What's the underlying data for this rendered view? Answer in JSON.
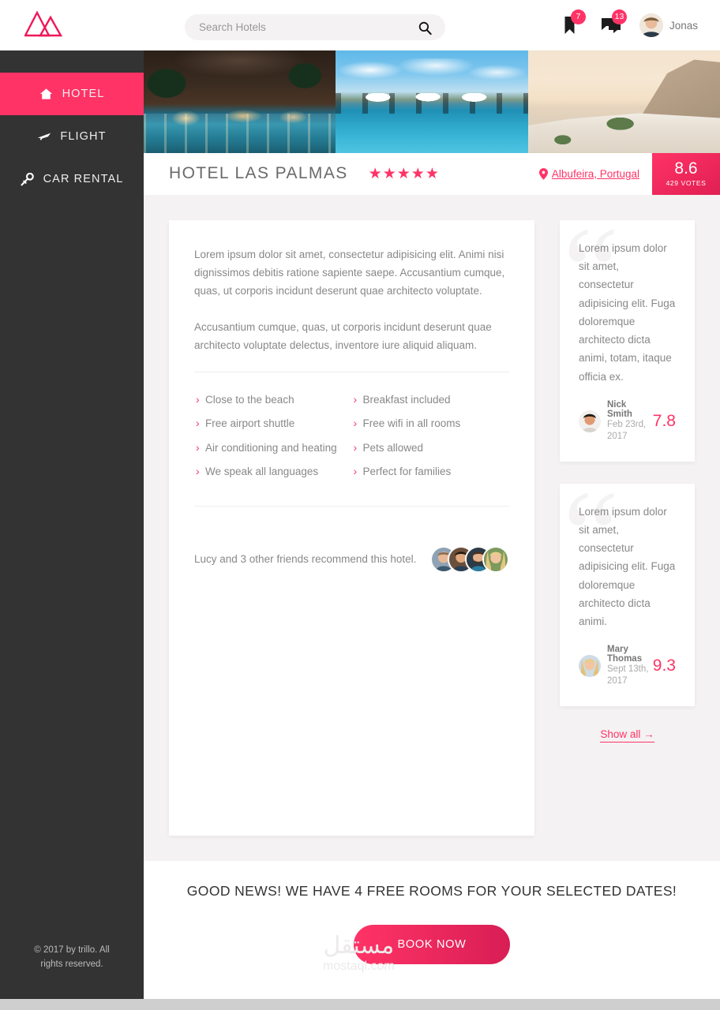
{
  "brand": {
    "logo_icon": "trillo-triangles-logo"
  },
  "search": {
    "placeholder": "Search Hotels",
    "value": "",
    "icon": "search-icon"
  },
  "user_nav": {
    "bookmark": {
      "icon": "bookmark-icon",
      "count": "7"
    },
    "messages": {
      "icon": "chat-bubbles-icon",
      "count": "13"
    },
    "user": {
      "name": "Jonas",
      "avatar": "user-avatar"
    }
  },
  "sidebar": {
    "items": [
      {
        "label": "HOTEL",
        "icon": "home-icon",
        "active": true
      },
      {
        "label": "FLIGHT",
        "icon": "airplane-icon",
        "active": false
      },
      {
        "label": "CAR RENTAL",
        "icon": "key-icon",
        "active": false
      }
    ],
    "legal": "© 2017 by trillo. All rights reserved."
  },
  "gallery": [
    {
      "alt": "Hotel pool at night with palm trees"
    },
    {
      "alt": "Poolside sun loungers and white umbrellas by day"
    },
    {
      "alt": "Clifftop terrace overlooking the sea at sunset"
    }
  ],
  "overview": {
    "name": "HOTEL LAS PALMAS",
    "stars": 5,
    "location": {
      "icon": "location-pin-icon",
      "label": "Albufeira, Portugal"
    },
    "rating": {
      "value": "8.6",
      "count": "429 VOTES"
    }
  },
  "description": {
    "paragraphs": [
      "Lorem ipsum dolor sit amet, consectetur adipisicing elit. Animi nisi dignissimos debitis ratione sapiente saepe. Accusantium cumque, quas, ut corporis incidunt deserunt quae architecto voluptate.",
      "Accusantium cumque, quas, ut corporis incidunt deserunt quae architecto voluptate delectus, inventore iure aliquid aliquam."
    ],
    "features": [
      "Close to the beach",
      "Breakfast included",
      "Free airport shuttle",
      "Free wifi in all rooms",
      "Air conditioning and heating",
      "Pets allowed",
      "We speak all languages",
      "Perfect for families"
    ],
    "recommend": {
      "text": "Lucy and 3 other friends recommend this hotel.",
      "friend_count": 4
    }
  },
  "reviews": [
    {
      "text": "Lorem ipsum dolor sit amet, consectetur adipisicing elit. Fuga doloremque architecto dicta animi, totam, itaque officia ex.",
      "name": "Nick Smith",
      "date": "Feb 23rd, 2017",
      "score": "7.8",
      "photo": "reviewer-avatar-nick"
    },
    {
      "text": "Lorem ipsum dolor sit amet, consectetur adipisicing elit. Fuga doloremque architecto dicta animi.",
      "name": "Mary Thomas",
      "date": "Sept 13th, 2017",
      "score": "9.3",
      "photo": "reviewer-avatar-mary"
    }
  ],
  "reviews_show_all": "Show all →",
  "cta": {
    "title": "GOOD NEWS! WE HAVE 4 FREE ROOMS FOR YOUR SELECTED DATES!",
    "button": "BOOK NOW"
  },
  "watermark": {
    "arabic": "مستقل",
    "latin": "mostaql.com"
  },
  "colors": {
    "primary": "#ff3366",
    "primary_dark": "#d81e55",
    "sidebar": "#333333",
    "page_bg": "#f4f2f2",
    "text": "#888888",
    "heading": "#6a6a6a"
  }
}
